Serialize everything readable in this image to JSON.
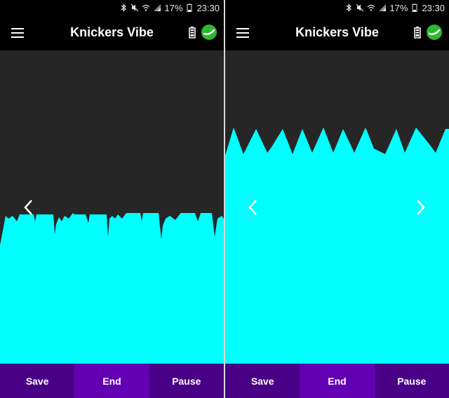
{
  "status_bar": {
    "battery_percent": "17%",
    "time": "23:30",
    "icons": [
      "bluetooth-icon",
      "mute-icon",
      "wifi-icon",
      "signal-icon",
      "battery-status-icon"
    ]
  },
  "app": {
    "title": "Knickers Vibe",
    "menu_icon": "hamburger-menu-icon",
    "battery_icon": "device-battery-icon",
    "connection_icon": "connection-status-icon"
  },
  "colors": {
    "wave": "#00ffff",
    "viz_background": "#262626",
    "button_dark": "#4a0086",
    "button_mid": "#6400b4",
    "connection": "#2eb82e"
  },
  "screens": [
    {
      "id": "left",
      "wave_level": 0.58,
      "arrows": [
        "chevron-left-icon"
      ],
      "buttons": {
        "save": "Save",
        "end": "End",
        "pause": "Pause"
      }
    },
    {
      "id": "right",
      "wave_level": 0.75,
      "arrows": [
        "chevron-left-icon",
        "chevron-right-icon"
      ],
      "buttons": {
        "save": "Save",
        "end": "End",
        "pause": "Pause"
      }
    }
  ]
}
